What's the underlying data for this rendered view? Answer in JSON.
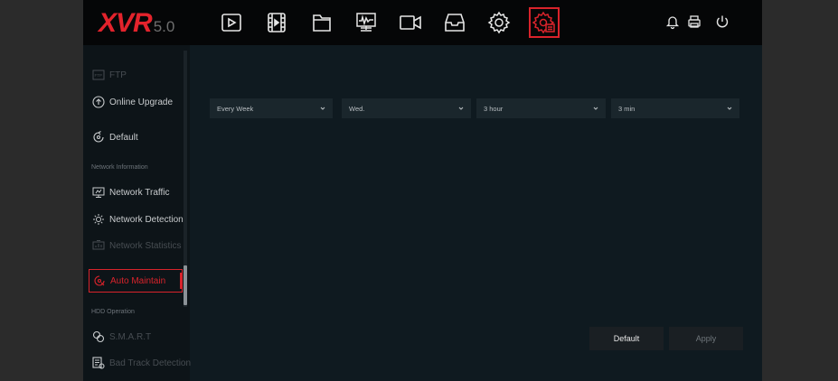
{
  "brand": {
    "name": "XVR",
    "version": "5.0",
    "accent": "#d9232b"
  },
  "topnav": {
    "icons": [
      "playback-icon",
      "video-clip-icon",
      "file-folder-icon",
      "monitor-chart-icon",
      "camera-icon",
      "storage-tray-icon",
      "settings-gear-icon",
      "system-maintain-icon"
    ],
    "active": "system-maintain-icon",
    "right_icons": [
      "bell-icon",
      "printer-icon",
      "power-icon"
    ]
  },
  "sidebar": {
    "items": [
      {
        "label": "FTP",
        "icon": "ftp-icon",
        "state": "dim"
      },
      {
        "label": "Online Upgrade",
        "icon": "upgrade-icon",
        "state": "normal"
      },
      {
        "label": "Default",
        "icon": "default-icon",
        "state": "normal"
      },
      {
        "label": "Network Traffic",
        "icon": "network-traffic-icon",
        "state": "normal"
      },
      {
        "label": "Network Detection",
        "icon": "network-detection-icon",
        "state": "normal"
      },
      {
        "label": "Network Statistics",
        "icon": "network-statistics-icon",
        "state": "dim"
      },
      {
        "label": "Auto Maintain",
        "icon": "auto-maintain-icon",
        "state": "active"
      },
      {
        "label": "S.M.A.R.T",
        "icon": "smart-icon",
        "state": "dim"
      },
      {
        "label": "Bad Track Detection",
        "icon": "bad-track-icon",
        "state": "dim"
      }
    ],
    "sections": [
      "Network Information",
      "HDD Operation"
    ]
  },
  "schedule": {
    "frequency": "Every Week",
    "day": "Wed.",
    "hour": "3 hour",
    "minute": "3 min"
  },
  "buttons": {
    "default": "Default",
    "apply": "Apply"
  }
}
